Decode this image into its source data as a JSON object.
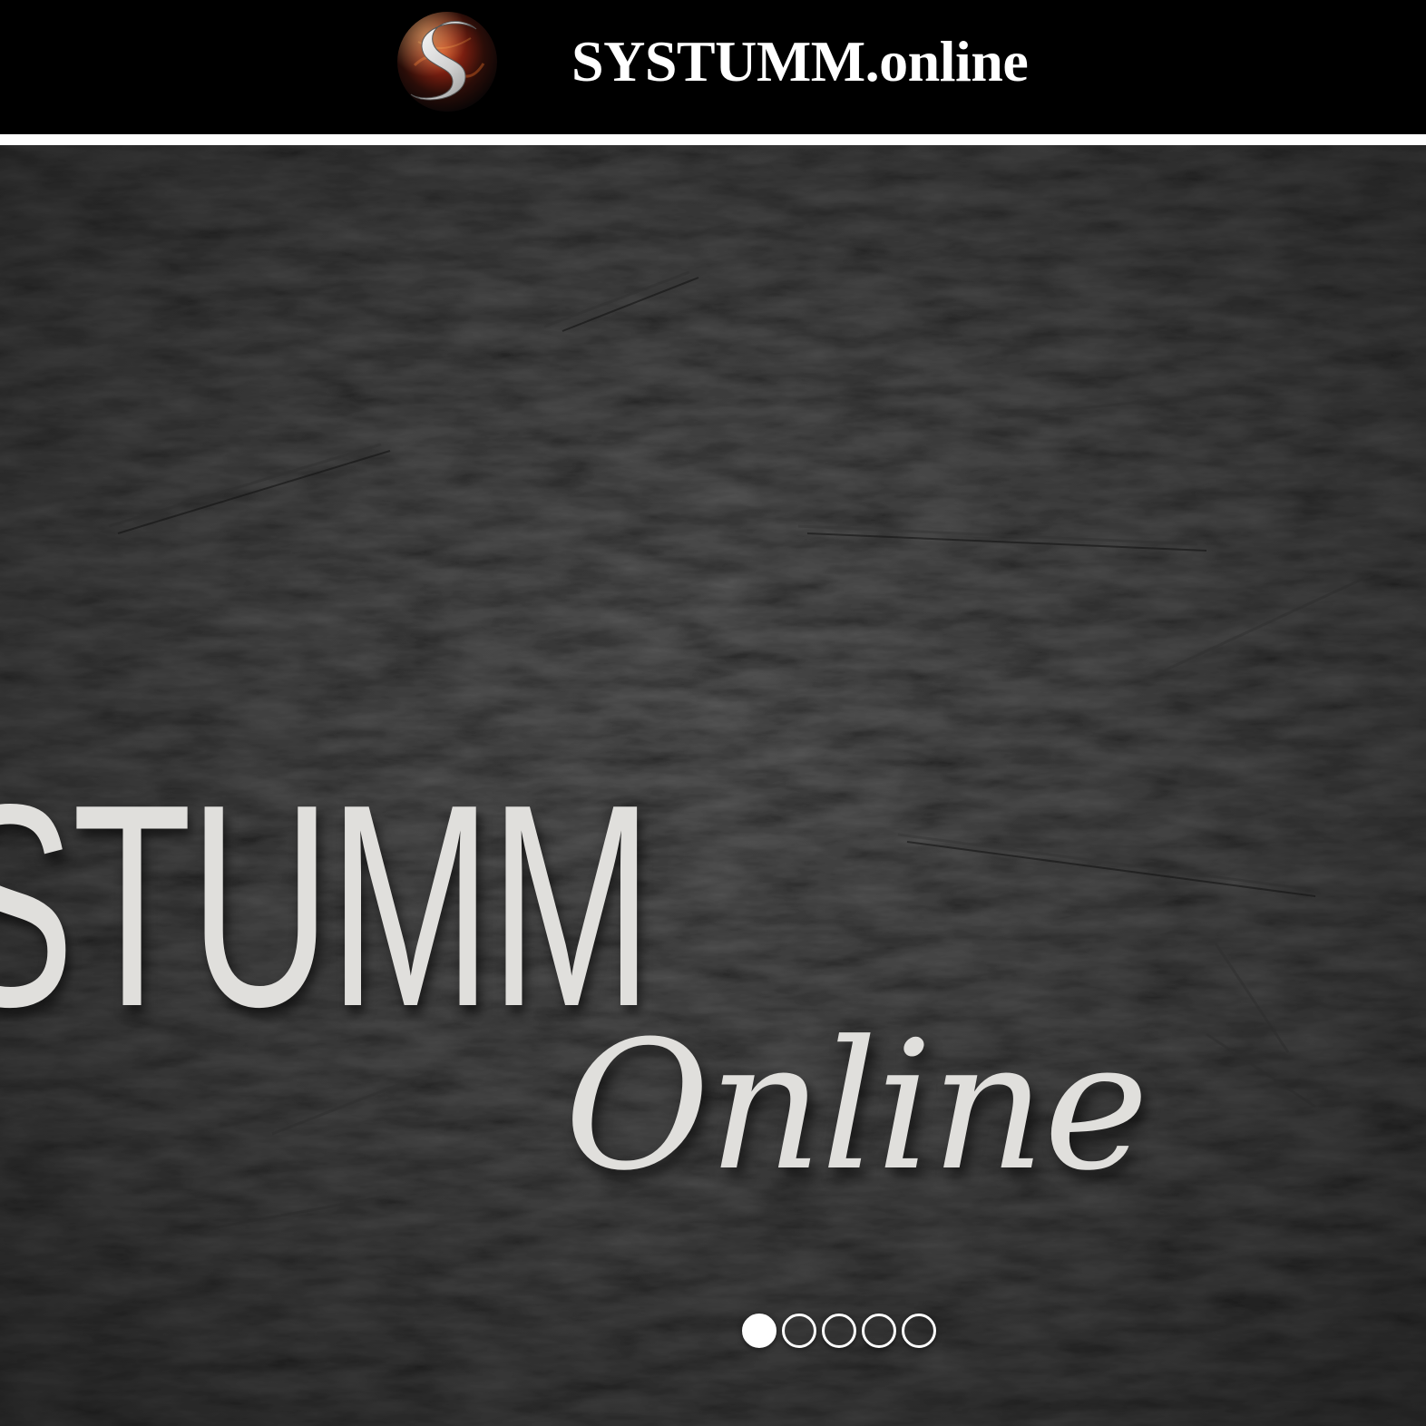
{
  "header": {
    "logo_icon": "s-monogram-logo-icon",
    "site_title": "SYSTUMM.online"
  },
  "hero": {
    "slide_wordmark": "STUMM",
    "slide_script": "Online",
    "pager": {
      "count": 5,
      "active_index": 0
    }
  },
  "colors": {
    "header_bg": "#000000",
    "divider": "#ffffff",
    "hero_bg": "#1e1e1e",
    "slide_text": "#e0dfdc",
    "dot": "#ffffff"
  }
}
